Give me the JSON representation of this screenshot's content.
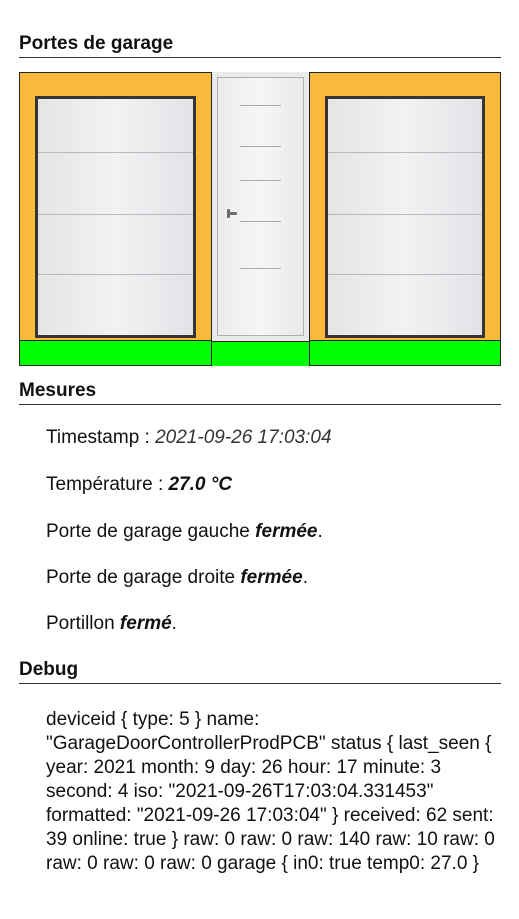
{
  "sections": {
    "garage_title": "Portes de garage",
    "mesures_title": "Mesures",
    "debug_title": "Debug"
  },
  "doors": {
    "left_garage": {
      "status": "fermée",
      "status_color": "#00ff00"
    },
    "portillon": {
      "status": "fermé",
      "status_color": "#00ff00"
    },
    "right_garage": {
      "status": "fermée",
      "status_color": "#00ff00"
    },
    "frame_color": "#fbb93c"
  },
  "mesures": {
    "timestamp_label": "Timestamp : ",
    "timestamp_value": "2021-09-26 17:03:04",
    "temperature_label": "Température : ",
    "temperature_value": "27.0 °C",
    "left_door_prefix": "Porte de garage gauche ",
    "left_door_state": "fermée",
    "right_door_prefix": "Porte de garage droite ",
    "right_door_state": "fermée",
    "portillon_prefix": "Portillon ",
    "portillon_state": "fermé",
    "suffix": "."
  },
  "debug": {
    "text": "deviceid { type: 5 } name: \"GarageDoorControllerProdPCB\" status { last_seen { year: 2021 month: 9 day: 26 hour: 17 minute: 3 second: 4 iso: \"2021-09-26T17:03:04.331453\" formatted: \"2021-09-26 17:03:04\" } received: 62 sent: 39 online: true } raw: 0 raw: 0 raw: 140 raw: 10 raw: 0 raw: 0 raw: 0 raw: 0 garage { in0: true temp0: 27.0 }"
  }
}
